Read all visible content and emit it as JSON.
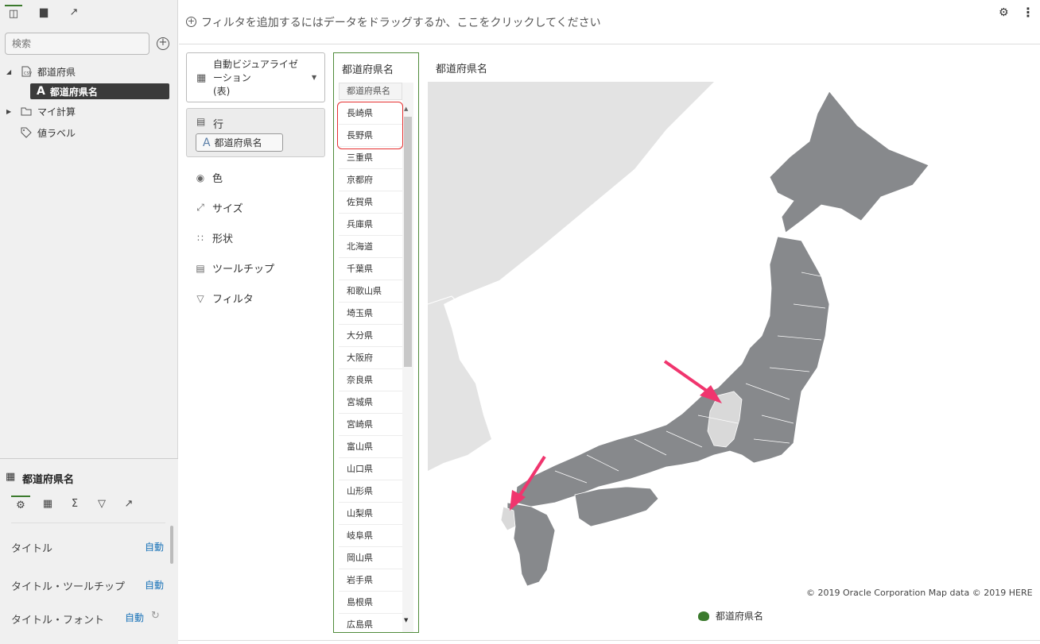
{
  "filter_bar": {
    "placeholder_text": "フィルタを追加するにはデータをドラッグするか、ここをクリックしてください"
  },
  "data_panel": {
    "search_placeholder": "検索",
    "tree": [
      {
        "label": "都道府県",
        "icon": "dataset-icon",
        "expanded": true
      },
      {
        "label": "都道府県名",
        "icon": "attribute-A-icon",
        "selected": true
      },
      {
        "label": "マイ計算",
        "icon": "folder-icon",
        "expanded": false
      },
      {
        "label": "値ラベル",
        "icon": "tag-icon"
      }
    ]
  },
  "properties_panel": {
    "title": "都道府県名",
    "props": [
      {
        "name": "タイトル",
        "value": "自動"
      },
      {
        "name": "タイトル・ツールチップ",
        "value": "自動"
      },
      {
        "name": "タイトル・フォント",
        "value": "自動"
      }
    ]
  },
  "grammar": {
    "viz_type": "自動ビジュアライゼ\nーション\n(表)",
    "rows_label": "行",
    "rows_pill": "都道府県名",
    "items": [
      "色",
      "サイズ",
      "形状",
      "ツールチップ",
      "フィルタ"
    ]
  },
  "table_viz": {
    "title": "都道府県名",
    "column_header": "都道府県名",
    "rows": [
      "長崎県",
      "長野県",
      "三重県",
      "京都府",
      "佐賀県",
      "兵庫県",
      "北海道",
      "千葉県",
      "和歌山県",
      "埼玉県",
      "大分県",
      "大阪府",
      "奈良県",
      "宮城県",
      "宮崎県",
      "富山県",
      "山口県",
      "山形県",
      "山梨県",
      "岐阜県",
      "岡山県",
      "岩手県",
      "島根県",
      "広島県"
    ]
  },
  "map_viz": {
    "title": "都道府県名",
    "copyright": "© 2019 Oracle Corporation   Map data © 2019 HERE",
    "legend_label": "都道府県名",
    "colors": {
      "land": "#87898c",
      "highlight": "#d9d9d9",
      "continent": "#e3e3e3",
      "annotation_arrow": "#f0356e"
    }
  }
}
